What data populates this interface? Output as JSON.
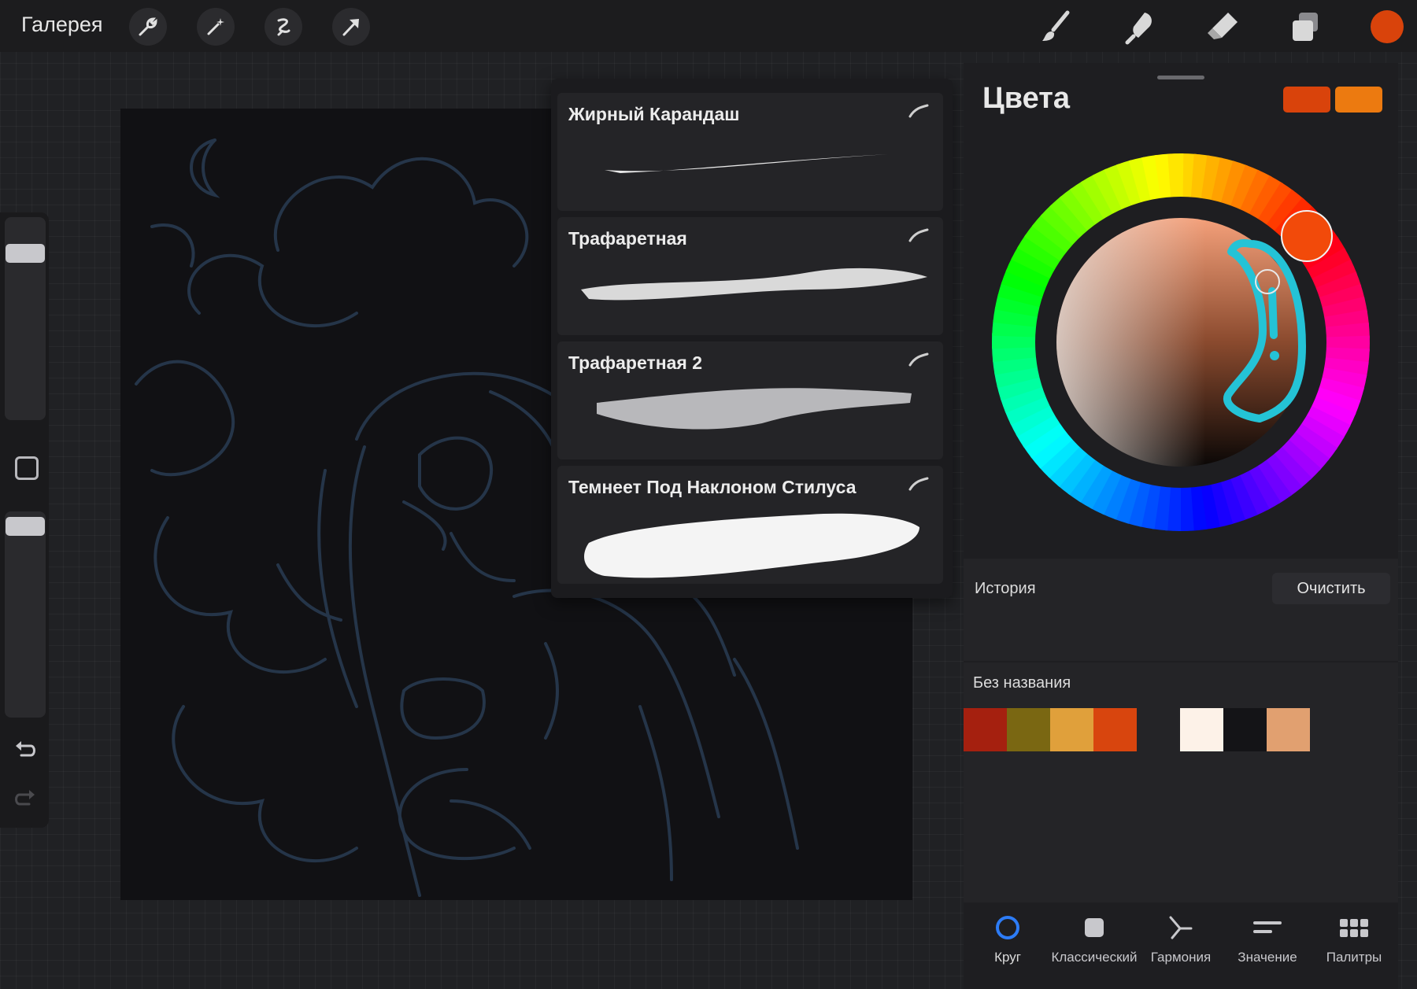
{
  "app": {
    "gallery_label": "Галерея"
  },
  "toolbar": {
    "left_tools": [
      "wrench-icon",
      "magic-wand-icon",
      "selection-icon",
      "transform-arrow-icon"
    ],
    "right_tools": [
      "brush-icon",
      "smudge-icon",
      "eraser-icon",
      "layers-icon"
    ],
    "current_color": "#d9430b"
  },
  "brushes": [
    {
      "name": "Жирный Карандаш"
    },
    {
      "name": "Трафаретная"
    },
    {
      "name": "Трафаретная 2"
    },
    {
      "name": "Темнеет Под Наклоном Стилуса"
    }
  ],
  "colors_panel": {
    "title": "Цвета",
    "primary_swatch": "#d9430b",
    "secondary_swatch": "#ec7a10",
    "history_label": "История",
    "clear_label": "Очистить",
    "palette_name": "Без названия",
    "palette_swatches": [
      "#a5200f",
      "#7a6712",
      "#e0a03b",
      "#d8450e",
      "#fdf2e8",
      "#141417",
      "#e1a070"
    ]
  },
  "tabs": [
    {
      "label": "Круг",
      "icon": "circle-icon",
      "active": true
    },
    {
      "label": "Классический",
      "icon": "square-icon",
      "active": false
    },
    {
      "label": "Гармония",
      "icon": "harmony-icon",
      "active": false
    },
    {
      "label": "Значение",
      "icon": "sliders-icon",
      "active": false
    },
    {
      "label": "Палитры",
      "icon": "grid-icon",
      "active": false
    }
  ]
}
